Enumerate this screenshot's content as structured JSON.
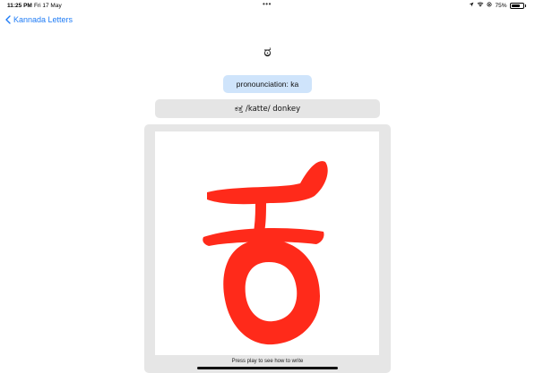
{
  "status_bar": {
    "time": "11:25 PM",
    "date": "Fri 17 May",
    "dots": "•••",
    "battery_text": "75%",
    "battery_level": 0.75,
    "icons": [
      "location-arrow-icon",
      "wifi-icon",
      "orientation-lock-icon",
      "battery-icon"
    ]
  },
  "nav": {
    "back_label": "Kannada Letters",
    "back_icon": "chevron-left-icon"
  },
  "letter": {
    "glyph": "ಠ",
    "pronunciation_label": "pronounciation: ka",
    "example": "ಕತ್ತೆ /katte/ donkey"
  },
  "stroke_panel": {
    "stroke_color": "#ff2a1a",
    "hint": "Press play to see how to write"
  },
  "colors": {
    "accent": "#1f7cf6",
    "pron_bg": "#cfe4fb",
    "panel_bg": "#e6e6e6"
  }
}
